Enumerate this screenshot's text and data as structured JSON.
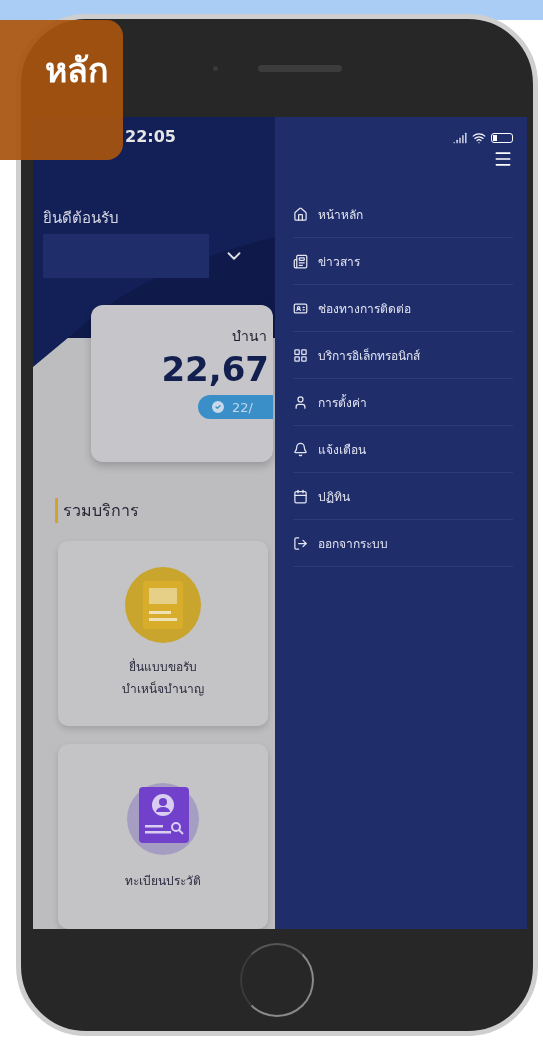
{
  "banner": {
    "label": "หลัก"
  },
  "status_bar": {
    "time": "22:05"
  },
  "home": {
    "greeting": "ยินดีต้อนรับ",
    "pension_card": {
      "label": "บำนา",
      "amount": "22,67",
      "badge": "22/"
    },
    "services_title": "รวมบริการ",
    "services": [
      {
        "label": "ยื่นแบบขอรับ\nบำเหน็จบำนาญ",
        "kind": "form"
      },
      {
        "label": "ทะเบียนประวัติ",
        "kind": "profile"
      }
    ]
  },
  "menu": {
    "items": [
      {
        "label": "หน้าหลัก"
      },
      {
        "label": "ข่าวสาร"
      },
      {
        "label": "ช่องทางการติดต่อ"
      },
      {
        "label": "บริการอิเล็กทรอนิกส์"
      },
      {
        "label": "การตั้งค่า"
      },
      {
        "label": "แจ้งเตือน"
      },
      {
        "label": "ปฏิทิน"
      },
      {
        "label": "ออกจากระบบ"
      }
    ]
  }
}
